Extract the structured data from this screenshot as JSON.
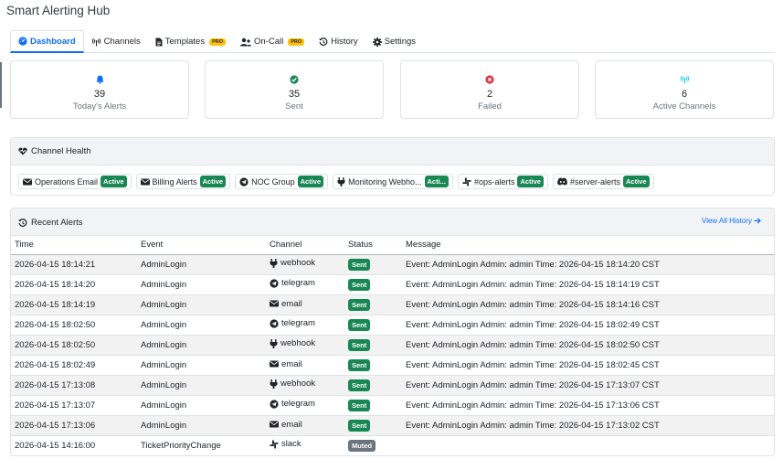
{
  "app": {
    "title": "Smart Alerting Hub"
  },
  "tabs": [
    {
      "label": "Dashboard",
      "icon": "dashboard-icon",
      "active": true
    },
    {
      "label": "Channels",
      "icon": "broadcast-icon"
    },
    {
      "label": "Templates",
      "icon": "file-icon",
      "badge": "PRO"
    },
    {
      "label": "On-Call",
      "icon": "users-icon",
      "badge": "PRO"
    },
    {
      "label": "History",
      "icon": "history-icon"
    },
    {
      "label": "Settings",
      "icon": "gear-icon"
    }
  ],
  "stats": [
    {
      "value": "39",
      "label": "Today's Alerts",
      "icon": "bell-icon",
      "color": "#0d6efd"
    },
    {
      "value": "35",
      "label": "Sent",
      "icon": "check-circle-icon",
      "color": "#198754"
    },
    {
      "value": "2",
      "label": "Failed",
      "icon": "x-circle-icon",
      "color": "#dc3545"
    },
    {
      "value": "6",
      "label": "Active Channels",
      "icon": "broadcast-icon",
      "color": "#0dcaf0"
    }
  ],
  "channel_health": {
    "title": "Channel Health",
    "channels": [
      {
        "name": "Operations Email",
        "type": "email",
        "status": "Active"
      },
      {
        "name": "Billing Alerts",
        "type": "email",
        "status": "Active"
      },
      {
        "name": "NOC Group",
        "type": "telegram",
        "status": "Active"
      },
      {
        "name": "Monitoring Webho...",
        "type": "webhook",
        "status": "Acti..."
      },
      {
        "name": "#ops-alerts",
        "type": "slack",
        "status": "Active"
      },
      {
        "name": "#server-alerts",
        "type": "discord",
        "status": "Active"
      }
    ]
  },
  "recent_alerts": {
    "title": "Recent Alerts",
    "view_all": "View All History",
    "columns": [
      "Time",
      "Event",
      "Channel",
      "Status",
      "Message"
    ],
    "rows": [
      {
        "time": "2026-04-15 18:14:21",
        "event": "AdminLogin",
        "channel": "webhook",
        "status": "Sent",
        "message": "Event: AdminLogin Admin: admin Time: 2026-04-15 18:14:20 CST"
      },
      {
        "time": "2026-04-15 18:14:20",
        "event": "AdminLogin",
        "channel": "telegram",
        "status": "Sent",
        "message": "Event: AdminLogin Admin: admin Time: 2026-04-15 18:14:19 CST"
      },
      {
        "time": "2026-04-15 18:14:19",
        "event": "AdminLogin",
        "channel": "email",
        "status": "Sent",
        "message": "Event: AdminLogin Admin: admin Time: 2026-04-15 18:14:16 CST"
      },
      {
        "time": "2026-04-15 18:02:50",
        "event": "AdminLogin",
        "channel": "telegram",
        "status": "Sent",
        "message": "Event: AdminLogin Admin: admin Time: 2026-04-15 18:02:49 CST"
      },
      {
        "time": "2026-04-15 18:02:50",
        "event": "AdminLogin",
        "channel": "webhook",
        "status": "Sent",
        "message": "Event: AdminLogin Admin: admin Time: 2026-04-15 18:02:50 CST"
      },
      {
        "time": "2026-04-15 18:02:49",
        "event": "AdminLogin",
        "channel": "email",
        "status": "Sent",
        "message": "Event: AdminLogin Admin: admin Time: 2026-04-15 18:02:45 CST"
      },
      {
        "time": "2026-04-15 17:13:08",
        "event": "AdminLogin",
        "channel": "webhook",
        "status": "Sent",
        "message": "Event: AdminLogin Admin: admin Time: 2026-04-15 17:13:07 CST"
      },
      {
        "time": "2026-04-15 17:13:07",
        "event": "AdminLogin",
        "channel": "telegram",
        "status": "Sent",
        "message": "Event: AdminLogin Admin: admin Time: 2026-04-15 17:13:06 CST"
      },
      {
        "time": "2026-04-15 17:13:06",
        "event": "AdminLogin",
        "channel": "email",
        "status": "Sent",
        "message": "Event: AdminLogin Admin: admin Time: 2026-04-15 17:13:02 CST"
      },
      {
        "time": "2026-04-15 14:16:00",
        "event": "TicketPriorityChange",
        "channel": "slack",
        "status": "Muted",
        "message": ""
      }
    ]
  },
  "colors": {
    "primary": "#0d6efd",
    "success": "#198754",
    "danger": "#dc3545",
    "info": "#0dcaf0",
    "warning": "#ffc107",
    "muted": "#6c757d"
  }
}
